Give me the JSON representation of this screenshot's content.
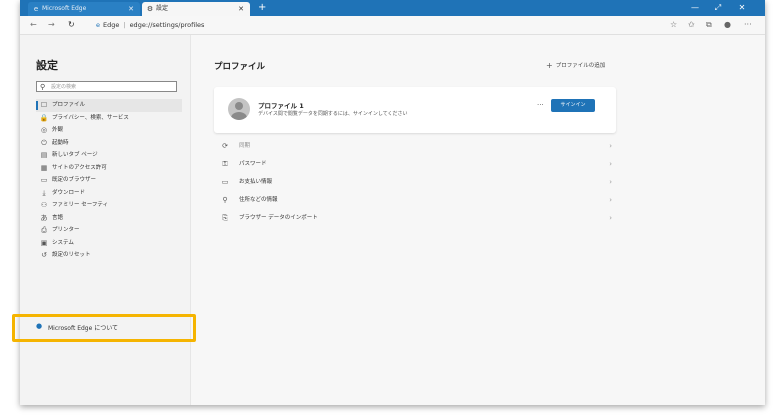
{
  "browser": {
    "tabs": [
      {
        "label": "Microsoft Edge",
        "icon": "edge-icon"
      },
      {
        "label": "設定",
        "icon": "gear-icon"
      }
    ],
    "new_tab": "+",
    "window_controls": {
      "minimize": "—",
      "maximize": "⤢",
      "close": "✕"
    },
    "address": {
      "site_label": "Edge",
      "url": "edge://settings/profiles"
    }
  },
  "sidebar": {
    "title": "設定",
    "search_placeholder": "設定の検索",
    "items": [
      {
        "label": "プロファイル",
        "icon": "profile-icon",
        "glyph": "☐",
        "active": true
      },
      {
        "label": "プライバシー、検索、サービス",
        "icon": "lock-icon",
        "glyph": "🔒"
      },
      {
        "label": "外観",
        "icon": "appearance-icon",
        "glyph": "◎"
      },
      {
        "label": "起動時",
        "icon": "power-icon",
        "glyph": "⏻"
      },
      {
        "label": "新しいタブ ページ",
        "icon": "newtab-icon",
        "glyph": "▤"
      },
      {
        "label": "サイトのアクセス許可",
        "icon": "site-permissions-icon",
        "glyph": "▦"
      },
      {
        "label": "既定のブラウザー",
        "icon": "browser-icon",
        "glyph": "▭"
      },
      {
        "label": "ダウンロード",
        "icon": "download-icon",
        "glyph": "⤓"
      },
      {
        "label": "ファミリー セーフティ",
        "icon": "family-icon",
        "glyph": "⚇"
      },
      {
        "label": "言語",
        "icon": "language-icon",
        "glyph": "あ"
      },
      {
        "label": "プリンター",
        "icon": "printer-icon",
        "glyph": "⎙"
      },
      {
        "label": "システム",
        "icon": "system-icon",
        "glyph": "▣"
      },
      {
        "label": "設定のリセット",
        "icon": "reset-icon",
        "glyph": "↺"
      }
    ],
    "about": "Microsoft Edge について"
  },
  "main": {
    "title": "プロファイル",
    "add_profile": "プロファイルの追加",
    "profile": {
      "name": "プロファイル 1",
      "description": "デバイス間で閲覧データを同期するには、サインインしてください",
      "more": "···",
      "signin": "サインイン"
    },
    "sections": [
      {
        "label": "同期",
        "icon": "sync-icon",
        "glyph": "⟳",
        "disabled": true
      },
      {
        "label": "パスワード",
        "icon": "key-icon",
        "glyph": "⚿"
      },
      {
        "label": "お支払い情報",
        "icon": "card-icon",
        "glyph": "▭"
      },
      {
        "label": "住所などの情報",
        "icon": "location-icon",
        "glyph": "⚲"
      },
      {
        "label": "ブラウザー データのインポート",
        "icon": "import-icon",
        "glyph": "⎘"
      }
    ]
  },
  "colors": {
    "accent": "#1f73b7",
    "highlight": "#f5b400"
  }
}
